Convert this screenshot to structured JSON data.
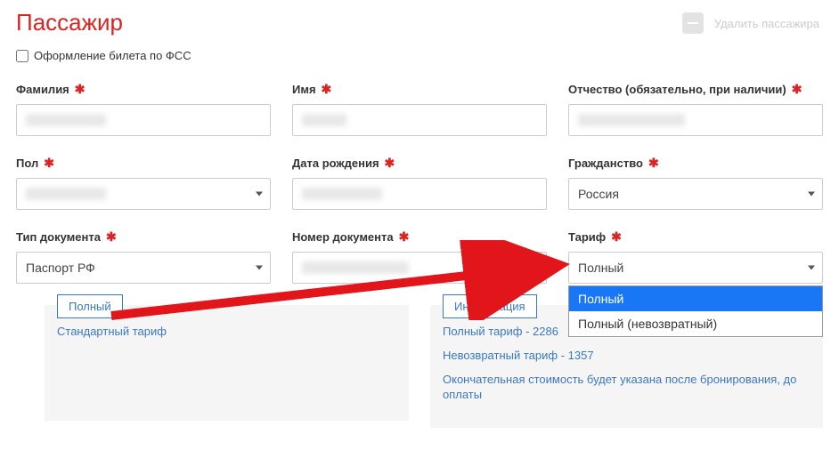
{
  "title": "Пассажир",
  "delete_label": "Удалить пассажира",
  "fss_label": "Оформление билета по ФСС",
  "fields": {
    "surname": {
      "label": "Фамилия"
    },
    "name": {
      "label": "Имя"
    },
    "patronymic": {
      "label": "Отчество (обязательно, при наличии)"
    },
    "gender": {
      "label": "Пол"
    },
    "dob": {
      "label": "Дата рождения"
    },
    "citizenship": {
      "label": "Гражданство",
      "value": "Россия"
    },
    "doc_type": {
      "label": "Тип документа",
      "value": "Паспорт РФ"
    },
    "doc_number": {
      "label": "Номер документа"
    },
    "tariff": {
      "label": "Тариф",
      "value": "Полный"
    }
  },
  "tariff_options": {
    "opt1": "Полный",
    "opt2": "Полный (невозвратный)"
  },
  "left_box": {
    "tab": "Полный",
    "line1": "Стандартный тариф"
  },
  "right_box": {
    "tab": "Информация",
    "line1": "Полный тариф - 2286",
    "line2": "Невозвратный тариф - 1357",
    "line3": "Окончательная стоимость будет указана после бронирования, до оплаты"
  }
}
